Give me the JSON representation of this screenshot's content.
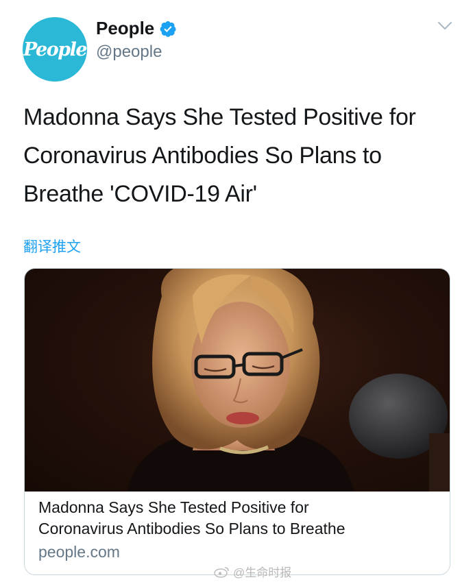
{
  "account": {
    "avatar_text": "People",
    "display_name": "People",
    "handle": "@people",
    "verified": true,
    "avatar_color": "#2bb7d6",
    "verified_color": "#1da1f2"
  },
  "tweet": {
    "lines": [
      "Madonna Says She Tested Positive for",
      "Coronavirus Antibodies So Plans to",
      "Breathe 'COVID-19 Air'"
    ],
    "translate_label": "翻译推文"
  },
  "card": {
    "image_alt": "Madonna wearing glasses with wavy blonde hair",
    "title_lines": [
      "Madonna Says She Tested Positive for",
      "Coronavirus Antibodies So Plans to Breathe"
    ],
    "domain": "people.com"
  },
  "watermark": {
    "text": "@生命时报",
    "icon": "weibo-icon"
  },
  "icons": {
    "menu": "chevron-down-icon",
    "verified": "verified-badge-icon"
  }
}
